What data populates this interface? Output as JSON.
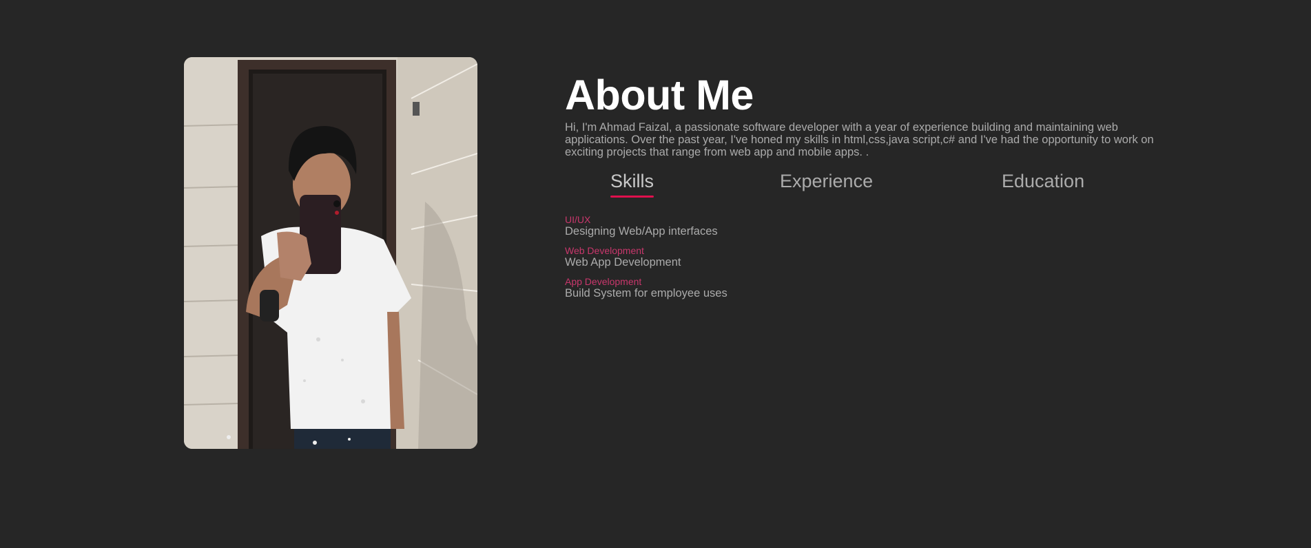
{
  "about": {
    "title": "About Me",
    "intro": "Hi, I'm Ahmad Faizal, a passionate software developer with a year of experience building and maintaining web applications. Over the past year, I've honed my skills in html,css,java script,c# and I've had the opportunity to work on exciting projects that range from web app and mobile apps. ."
  },
  "tabs": [
    {
      "label": "Skills",
      "active": true
    },
    {
      "label": "Experience",
      "active": false
    },
    {
      "label": "Education",
      "active": false
    }
  ],
  "skills": [
    {
      "name": "UI/UX",
      "desc": "Designing Web/App interfaces"
    },
    {
      "name": "Web Development",
      "desc": "Web App Development"
    },
    {
      "name": "App Development",
      "desc": "Build System for employee uses"
    }
  ],
  "colors": {
    "background": "#262626",
    "accent": "#e0104d",
    "skill_name": "#c9376c",
    "text_muted": "#ababab",
    "title": "#ffffff"
  }
}
